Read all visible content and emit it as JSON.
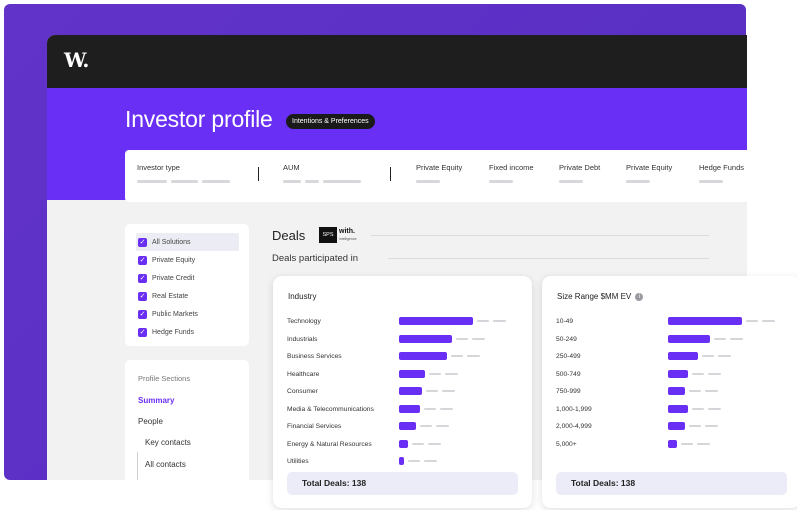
{
  "brand": {
    "logo_text": "W."
  },
  "header": {
    "title": "Investor profile",
    "pill": "Intentions & Preferences"
  },
  "info_columns": [
    {
      "label": "Investor type"
    },
    {
      "label": "AUM"
    },
    {
      "label": "Private Equity"
    },
    {
      "label": "Fixed income"
    },
    {
      "label": "Private Debt"
    },
    {
      "label": "Private Equity"
    },
    {
      "label": "Hedge Funds"
    }
  ],
  "filters": {
    "items": [
      {
        "label": "All Solutions",
        "checked": true
      },
      {
        "label": "Private Equity",
        "checked": true
      },
      {
        "label": "Private Credit",
        "checked": true
      },
      {
        "label": "Real Estate",
        "checked": true
      },
      {
        "label": "Public Markets",
        "checked": true
      },
      {
        "label": "Hedge Funds",
        "checked": true
      }
    ]
  },
  "profile_sections": {
    "heading": "Profile Sections",
    "items": [
      {
        "label": "Summary",
        "active": true
      },
      {
        "label": "People"
      },
      {
        "label": "Key contacts"
      },
      {
        "label": "All contacts"
      }
    ]
  },
  "deals": {
    "title": "Deals",
    "logo_sps": "SPS",
    "logo_with": "with.",
    "logo_with_sub": "intelligence",
    "subtitle": "Deals participated in"
  },
  "industry_panel": {
    "title": "Industry",
    "rows": [
      {
        "label": "Technology",
        "value": 1.0
      },
      {
        "label": "Industrials",
        "value": 0.72
      },
      {
        "label": "Business Services",
        "value": 0.65
      },
      {
        "label": "Healthcare",
        "value": 0.35
      },
      {
        "label": "Consumer",
        "value": 0.31
      },
      {
        "label": "Media & Telecommunications",
        "value": 0.28
      },
      {
        "label": "Financial Services",
        "value": 0.23
      },
      {
        "label": "Energy & Natural Resources",
        "value": 0.12
      },
      {
        "label": "Utilities",
        "value": 0.07
      }
    ],
    "total": "Total Deals: 138"
  },
  "size_panel": {
    "title": "Size Range $MM EV",
    "info_icon": "i",
    "rows": [
      {
        "label": "10-49",
        "value": 1.0
      },
      {
        "label": "50-249",
        "value": 0.57
      },
      {
        "label": "250-499",
        "value": 0.4
      },
      {
        "label": "500-749",
        "value": 0.27
      },
      {
        "label": "750-999",
        "value": 0.23
      },
      {
        "label": "1,000-1,999",
        "value": 0.27
      },
      {
        "label": "2,000-4,999",
        "value": 0.23
      },
      {
        "label": "5,000+",
        "value": 0.12
      }
    ],
    "total": "Total Deals: 138"
  },
  "colors": {
    "accent": "#6a2ff5",
    "frame": "#5a2fc4",
    "topbar": "#1e1e1e"
  }
}
